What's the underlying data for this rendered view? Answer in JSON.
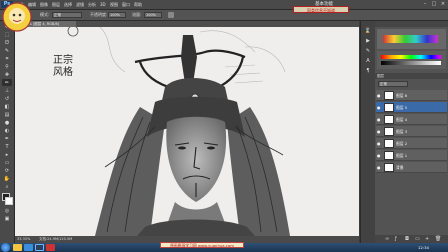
{
  "app": {
    "logo": "Ps",
    "essentials": "基本功能"
  },
  "menu": [
    "文件",
    "编辑",
    "图像",
    "图层",
    "选择",
    "滤镜",
    "分析",
    "3D",
    "视图",
    "窗口",
    "帮助"
  ],
  "window_buttons": {
    "min": "–",
    "max": "□",
    "close": "×"
  },
  "options": {
    "mode_label": "模式:",
    "mode_value": "正常",
    "opacity_label": "不透明度:",
    "opacity_value": "100%",
    "flow_label": "流量:",
    "flow_value": "100%"
  },
  "document": {
    "tab_label": "@ 33.3% (图层 4, RGB/8)"
  },
  "canvas": {
    "handwritten_note": "正宗 风格"
  },
  "status": {
    "zoom": "33.33%",
    "doc_info": "文档:24.9M/120.5M"
  },
  "layers_panel": {
    "header": "图层",
    "blend_mode": "正常",
    "layers": [
      {
        "name": "图层 6",
        "selected": false
      },
      {
        "name": "图层 5",
        "selected": true
      },
      {
        "name": "图层 4",
        "selected": false
      },
      {
        "name": "图层 3",
        "selected": false
      },
      {
        "name": "图层 2",
        "selected": false
      },
      {
        "name": "图层 1",
        "selected": false
      },
      {
        "name": "背景",
        "selected": false
      }
    ]
  },
  "overlays": {
    "top_banner": "同类信息不知道",
    "bottom_banner": "原画原画学习网 www.yuanhua.com"
  },
  "taskbar": {
    "clock": "12:34"
  },
  "colors": {
    "accent": "#3b6aa8",
    "banner_red": "#c01010"
  }
}
